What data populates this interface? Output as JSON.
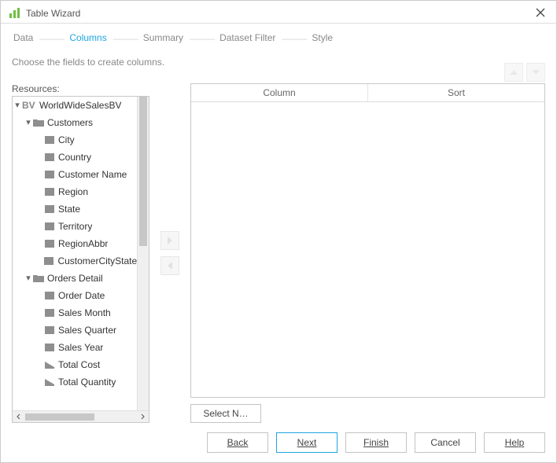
{
  "window": {
    "title": "Table Wizard"
  },
  "steps": {
    "items": [
      {
        "label": "Data",
        "active": false
      },
      {
        "label": "Columns",
        "active": true
      },
      {
        "label": "Summary",
        "active": false
      },
      {
        "label": "Dataset Filter",
        "active": false
      },
      {
        "label": "Style",
        "active": false
      }
    ],
    "subtitle": "Choose the fields to create columns."
  },
  "resources": {
    "label": "Resources:",
    "root": {
      "label": "WorldWideSalesBV",
      "icon": "bv",
      "expanded": true
    },
    "groups": [
      {
        "label": "Customers",
        "expanded": true,
        "items": [
          "City",
          "Country",
          "Customer Name",
          "Region",
          "State",
          "Territory",
          "RegionAbbr",
          "CustomerCityStateZ"
        ]
      },
      {
        "label": "Orders Detail",
        "expanded": true,
        "items": [
          "Order Date",
          "Sales Month",
          "Sales Quarter",
          "Sales Year",
          "Total Cost",
          "Total Quantity"
        ]
      }
    ]
  },
  "columns_table": {
    "headers": [
      "Column",
      "Sort"
    ]
  },
  "select_none": "Select N…",
  "footer": {
    "back": "Back",
    "next": "Next",
    "finish": "Finish",
    "cancel": "Cancel",
    "help": "Help"
  }
}
